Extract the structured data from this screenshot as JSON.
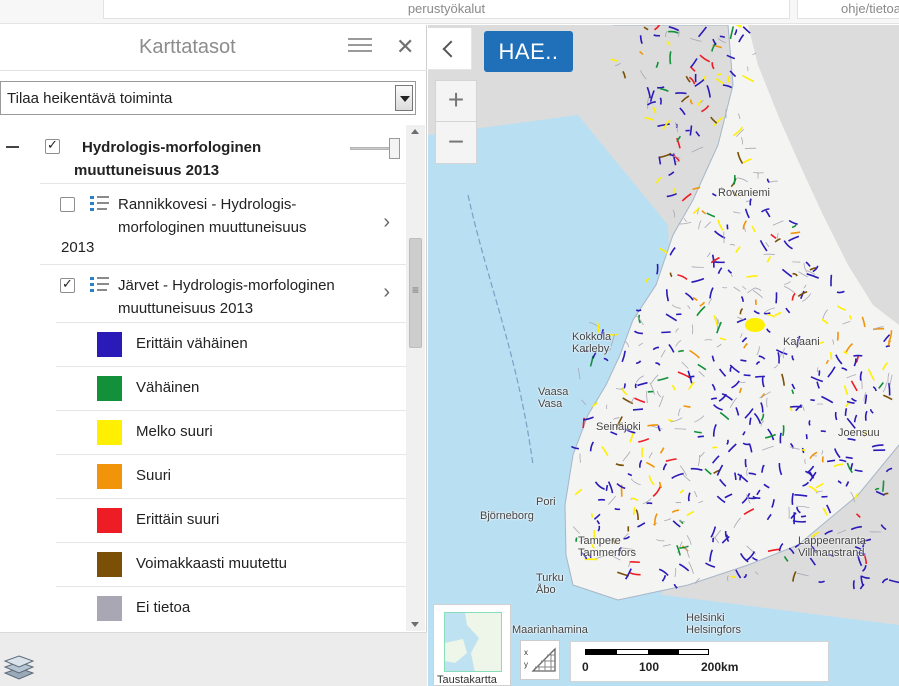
{
  "toolbar": {
    "tools_tab": "perustyökalut",
    "help_tab": "ohje/tietoa"
  },
  "panel": {
    "title": "Karttatasot",
    "service_select": {
      "value": "Tilaa heikentävä toiminta"
    },
    "group": {
      "name_line1": "Hydrologis-morfologinen",
      "name_line2": "muuttuneisuus 2013",
      "checked": true
    },
    "layers": [
      {
        "line1": "Rannikkovesi - Hydrologis-",
        "line2": "morfologinen muuttuneisuus",
        "line3": "2013",
        "checked": false
      },
      {
        "line1": "Järvet - Hydrologis-morfologinen",
        "line2": "muuttuneisuus 2013",
        "checked": true
      }
    ],
    "legend": [
      {
        "label": "Erittäin vähäinen",
        "color": "#2a1ab8"
      },
      {
        "label": "Vähäinen",
        "color": "#12913a"
      },
      {
        "label": "Melko suuri",
        "color": "#ffef00"
      },
      {
        "label": "Suuri",
        "color": "#f1940a"
      },
      {
        "label": "Erittäin suuri",
        "color": "#ee1c25"
      },
      {
        "label": "Voimakkaasti muutettu",
        "color": "#7a4f06"
      },
      {
        "label": "Ei tietoa",
        "color": "#aaa7b5"
      }
    ]
  },
  "map": {
    "search_button": "HAE..",
    "zoom_in": "+",
    "zoom_out": "−",
    "background_label": "Taustakartta",
    "place_labels": [
      "Kokkola",
      "Karleby",
      "Vaasa",
      "Vasa",
      "Seinäjoki",
      "Pori",
      "Björneborg",
      "Tampere",
      "Tammerfors",
      "Turku",
      "Åbo",
      "Maarianhamina",
      "Helsinki",
      "Helsingfors",
      "Lappeenranta",
      "Villmanstrand",
      "Joensuu",
      "Rovaniemi",
      "Kajaani"
    ],
    "scale": {
      "v0": "0",
      "v1": "100",
      "v2": "200km"
    },
    "colors": {
      "sea": "#b9dff2",
      "land": "#f4f4f2",
      "foreign": "#dcdcdc"
    }
  }
}
